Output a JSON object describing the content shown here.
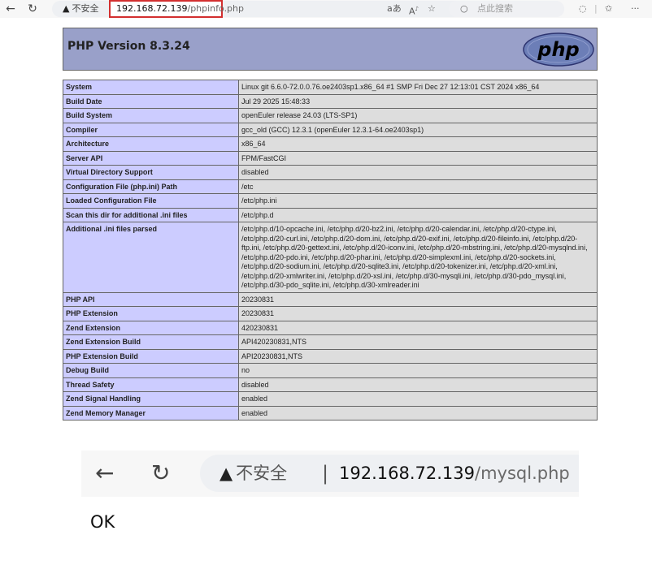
{
  "browser_top": {
    "security_label": "不安全",
    "url_host": "192.168.72.139",
    "url_path": "/phpinfo.php",
    "search_placeholder": "点此搜索"
  },
  "phpinfo": {
    "title": "PHP Version 8.3.24",
    "logo_text": "php",
    "rows": [
      {
        "k": "System",
        "v": "Linux git 6.6.0-72.0.0.76.oe2403sp1.x86_64 #1 SMP Fri Dec 27 12:13:01 CST 2024 x86_64"
      },
      {
        "k": "Build Date",
        "v": "Jul 29 2025 15:48:33"
      },
      {
        "k": "Build System",
        "v": "openEuler release 24.03 (LTS-SP1)"
      },
      {
        "k": "Compiler",
        "v": "gcc_old (GCC) 12.3.1 (openEuler 12.3.1-64.oe2403sp1)"
      },
      {
        "k": "Architecture",
        "v": "x86_64"
      },
      {
        "k": "Server API",
        "v": "FPM/FastCGI"
      },
      {
        "k": "Virtual Directory Support",
        "v": "disabled"
      },
      {
        "k": "Configuration File (php.ini) Path",
        "v": "/etc"
      },
      {
        "k": "Loaded Configuration File",
        "v": "/etc/php.ini"
      },
      {
        "k": "Scan this dir for additional .ini files",
        "v": "/etc/php.d"
      },
      {
        "k": "Additional .ini files parsed",
        "v": "/etc/php.d/10-opcache.ini, /etc/php.d/20-bz2.ini, /etc/php.d/20-calendar.ini, /etc/php.d/20-ctype.ini, /etc/php.d/20-curl.ini, /etc/php.d/20-dom.ini, /etc/php.d/20-exif.ini, /etc/php.d/20-fileinfo.ini, /etc/php.d/20-ftp.ini, /etc/php.d/20-gettext.ini, /etc/php.d/20-iconv.ini, /etc/php.d/20-mbstring.ini, /etc/php.d/20-mysqlnd.ini, /etc/php.d/20-pdo.ini, /etc/php.d/20-phar.ini, /etc/php.d/20-simplexml.ini, /etc/php.d/20-sockets.ini, /etc/php.d/20-sodium.ini, /etc/php.d/20-sqlite3.ini, /etc/php.d/20-tokenizer.ini, /etc/php.d/20-xml.ini, /etc/php.d/20-xmlwriter.ini, /etc/php.d/20-xsl.ini, /etc/php.d/30-mysqli.ini, /etc/php.d/30-pdo_mysql.ini, /etc/php.d/30-pdo_sqlite.ini, /etc/php.d/30-xmlreader.ini"
      },
      {
        "k": "PHP API",
        "v": "20230831"
      },
      {
        "k": "PHP Extension",
        "v": "20230831"
      },
      {
        "k": "Zend Extension",
        "v": "420230831"
      },
      {
        "k": "Zend Extension Build",
        "v": "API420230831,NTS"
      },
      {
        "k": "PHP Extension Build",
        "v": "API20230831,NTS"
      },
      {
        "k": "Debug Build",
        "v": "no"
      },
      {
        "k": "Thread Safety",
        "v": "disabled"
      },
      {
        "k": "Zend Signal Handling",
        "v": "enabled"
      },
      {
        "k": "Zend Memory Manager",
        "v": "enabled"
      }
    ]
  },
  "browser_zoom": {
    "security_label": "不安全",
    "separator": "|",
    "url_host": "192.168.72.139",
    "url_path": "/mysql.php"
  },
  "page_output": "OK"
}
